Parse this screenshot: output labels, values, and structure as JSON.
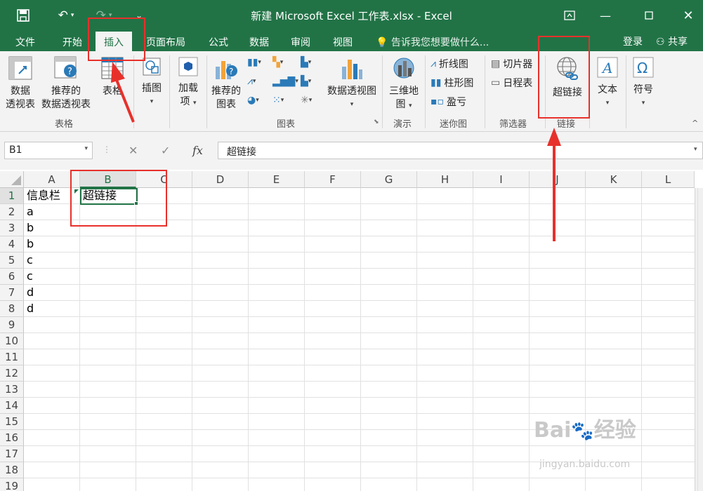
{
  "window": {
    "title": "新建 Microsoft Excel 工作表.xlsx - Excel"
  },
  "tabs": [
    "文件",
    "开始",
    "插入",
    "页面布局",
    "公式",
    "数据",
    "审阅",
    "视图"
  ],
  "active_tab": "插入",
  "tell_me": "告诉我您想要做什么...",
  "account": {
    "login": "登录",
    "share": "共享"
  },
  "ribbon": {
    "pivot_table": [
      "数据",
      "透视表"
    ],
    "recommended_pivot": [
      "推荐的",
      "数据透视表"
    ],
    "table": "表格",
    "group_tables": "表格",
    "illustrations": "插图",
    "addins": [
      "加载",
      "项"
    ],
    "recommended_charts": [
      "推荐的",
      "图表"
    ],
    "pivot_chart": "数据透视图",
    "group_charts": "图表",
    "map_3d": [
      "三维地",
      "图"
    ],
    "group_tours": "演示",
    "spark_line": "折线图",
    "spark_column": "柱形图",
    "spark_winloss": "盈亏",
    "group_sparklines": "迷你图",
    "slicer": "切片器",
    "timeline": "日程表",
    "group_filters": "筛选器",
    "hyperlink": "超链接",
    "group_links": "链接",
    "text": "文本",
    "symbol": "符号"
  },
  "formula_bar": {
    "name_box": "B1",
    "content": "超链接"
  },
  "grid": {
    "columns": [
      "A",
      "B",
      "C",
      "D",
      "E",
      "F",
      "G",
      "H",
      "I",
      "J",
      "K",
      "L"
    ],
    "rows": [
      "1",
      "2",
      "3",
      "4",
      "5",
      "6",
      "7",
      "8",
      "9",
      "10",
      "11",
      "12",
      "13",
      "14",
      "15",
      "16",
      "17",
      "18",
      "19"
    ],
    "cells": {
      "A1": "信息栏",
      "B1": "超链接",
      "A2": "a",
      "A3": "b",
      "A4": "b",
      "A5": "c",
      "A6": "c",
      "A7": "d",
      "A8": "d"
    }
  },
  "watermark": {
    "brand": "Bai",
    "brand2": "经验",
    "url": "jingyan.baidu.com"
  },
  "colors": {
    "excel_green": "#217346",
    "annotation_red": "#e8302b"
  }
}
